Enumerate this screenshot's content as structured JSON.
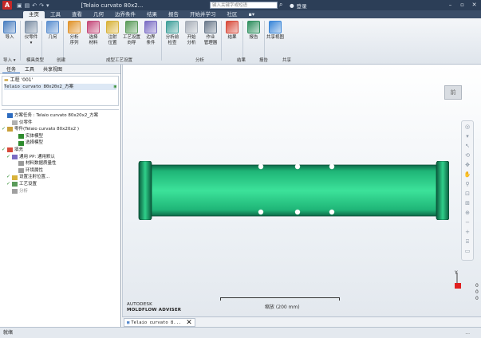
{
  "window": {
    "app_logo": "A",
    "title": "[Telaio curvato 80x2...",
    "search_placeholder": "键入关键字或短语",
    "login_label": "登录",
    "controls": [
      "–",
      "▫",
      "✕"
    ]
  },
  "ribbon_tabs": [
    "主页",
    "工具",
    "查看",
    "几何",
    "边界条件",
    "结果",
    "报告",
    "开始并学习",
    "社区",
    "▪▾"
  ],
  "ribbon_buttons": [
    {
      "label": "导入",
      "color": "#4a7fc1"
    },
    {
      "label": "仪零件\n▾",
      "color": "#7a8da3"
    },
    {
      "label": "几何",
      "color": "#5b8fd0"
    },
    {
      "label": "分析\n序列",
      "color": "#e0932b"
    },
    {
      "label": "选择\n材料",
      "color": "#c44a7a"
    },
    {
      "label": "注射\n位置",
      "color": "#d8b23a"
    },
    {
      "label": "工艺设置\n向导",
      "color": "#5a9b5a"
    },
    {
      "label": "边界\n条件",
      "color": "#7a6cc4"
    },
    {
      "label": "分析前\n检查",
      "color": "#3f9f9a"
    },
    {
      "label": "开始\n分析",
      "color": "#a7aeb8"
    },
    {
      "label": "作业\n管理器",
      "color": "#6b7a8c"
    },
    {
      "label": "结果",
      "color": "#d84a3a"
    },
    {
      "label": "报告",
      "color": "#2f8f5f"
    },
    {
      "label": "共享视图",
      "color": "#3a86d8"
    }
  ],
  "ribbon_groups": [
    "导入 ▾",
    "模具类型",
    "创建",
    "成型工艺设置",
    "分析",
    "结果",
    "报告",
    "共享"
  ],
  "left_panel": {
    "tabs": [
      "任务",
      "工具",
      "共享视图"
    ],
    "project_title": "工程 '001'",
    "project_item": "Telaio curvato 80x20x2_方案",
    "tree": [
      {
        "text": "方案任务 : Telaio curvato 80x20x2_方案",
        "check": ""
      },
      {
        "text": "仪零件",
        "check": ""
      },
      {
        "text": "零件(Telaio curvato 80x20x2 )",
        "check": "✓"
      },
      {
        "text": "实体模型",
        "check": ""
      },
      {
        "text": "选择模型",
        "check": ""
      },
      {
        "text": "填充",
        "check": "✓"
      },
      {
        "text": "通用 PP: 通用默认",
        "check": "✓"
      },
      {
        "text": "材料数据质量性",
        "check": ""
      },
      {
        "text": "环境属性",
        "check": ""
      },
      {
        "text": "设置注射位置...",
        "check": "✓"
      },
      {
        "text": "工艺设置",
        "check": "✓"
      },
      {
        "text": "分析",
        "check": ""
      }
    ]
  },
  "viewport": {
    "viewcube_label": "前",
    "brand_line1": "AUTODESK",
    "brand_line2": "MOLDFLOW ADVISER",
    "scale_label": "缩放 (200 mm)",
    "axis_label": "Y",
    "coords": [
      "0",
      "0",
      "0"
    ],
    "part_color": "#2fd08a"
  },
  "doc_tab": {
    "label": "Telaio curvato 8..."
  },
  "status": {
    "left": "就绪",
    "right": "..."
  }
}
